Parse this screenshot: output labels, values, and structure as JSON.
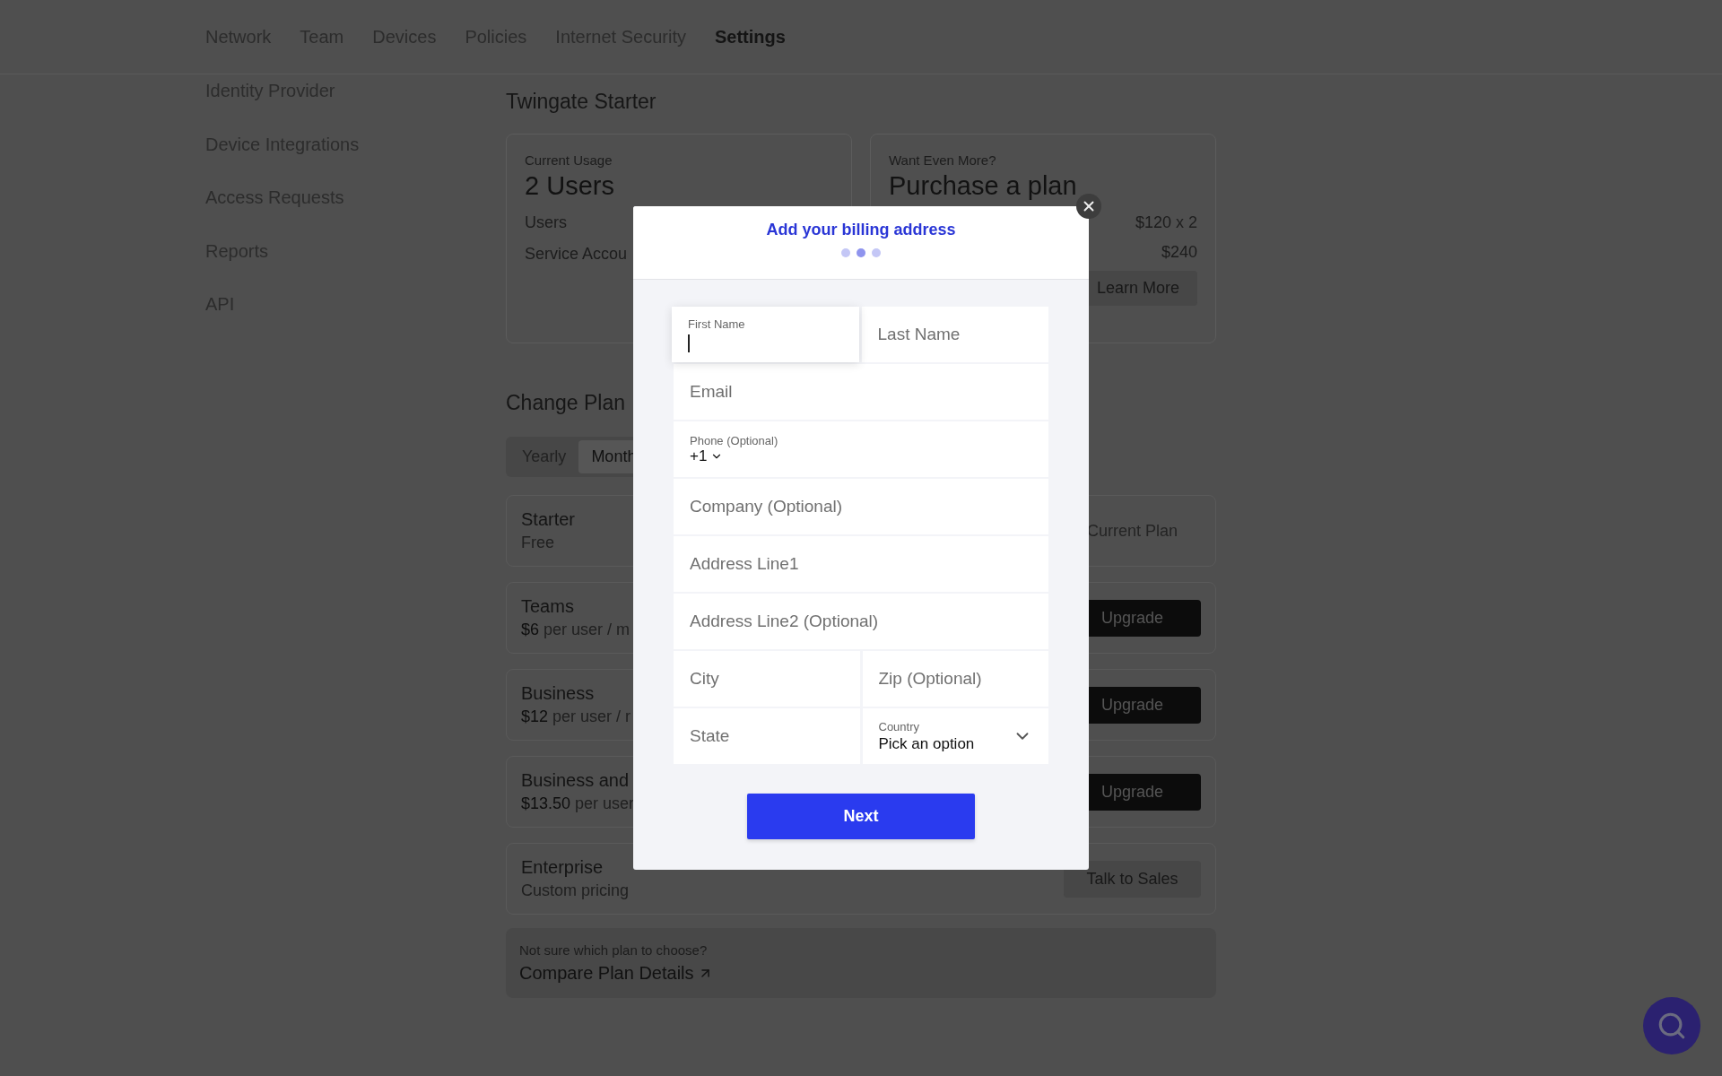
{
  "nav": {
    "tabs": [
      {
        "label": "Network",
        "selected": false
      },
      {
        "label": "Team",
        "selected": false
      },
      {
        "label": "Devices",
        "selected": false
      },
      {
        "label": "Policies",
        "selected": false
      },
      {
        "label": "Internet Security",
        "selected": false
      },
      {
        "label": "Settings",
        "selected": true
      }
    ]
  },
  "sidebar": {
    "items": [
      "Identity Provider",
      "Device Integrations",
      "Access Requests",
      "Reports",
      "API"
    ]
  },
  "starter": {
    "title": "Twingate Starter",
    "usage": {
      "caption": "Current Usage",
      "headline": "2 Users",
      "rows": [
        "Users",
        "Service Accou"
      ]
    },
    "purchase": {
      "caption": "Want Even More?",
      "headline": "Purchase a plan",
      "lines": [
        {
          "amount": "$120",
          "note": "x 2"
        },
        {
          "amount": "$240"
        }
      ],
      "button": "Learn More"
    }
  },
  "change_plan": {
    "title": "Change Plan",
    "billing_tabs": [
      {
        "label": "Yearly",
        "selected": false
      },
      {
        "label": "Month",
        "selected": true
      }
    ],
    "plans": [
      {
        "name": "Starter",
        "price_note": "Free",
        "action": {
          "kind": "current",
          "label": "Current Plan"
        }
      },
      {
        "name": "Teams",
        "price": "$6",
        "price_note": "per user / m",
        "action": {
          "kind": "upgrade",
          "label": "Upgrade"
        }
      },
      {
        "name": "Business",
        "price": "$12",
        "price_note": "per user / r",
        "action": {
          "kind": "upgrade",
          "label": "Upgrade"
        }
      },
      {
        "name": "Business and",
        "price": "$13.50",
        "price_note": "per user",
        "action": {
          "kind": "upgrade",
          "label": "Upgrade"
        }
      },
      {
        "name": "Enterprise",
        "price_note": "Custom pricing",
        "action": {
          "kind": "contact",
          "label": "Talk to Sales"
        }
      }
    ],
    "compare": {
      "question": "Not sure which plan to choose?",
      "link": "Compare Plan Details"
    }
  },
  "modal": {
    "title": "Add your billing address",
    "steps": [
      {
        "selected": false
      },
      {
        "selected": true
      },
      {
        "selected": false
      }
    ],
    "form_rows": [
      {
        "fields": [
          {
            "kind": "text",
            "label": "First Name",
            "focused": true
          },
          {
            "kind": "text",
            "label": "Last Name",
            "focused": false
          }
        ]
      },
      {
        "fields": [
          {
            "kind": "text",
            "label": "Email",
            "focused": false
          }
        ]
      },
      {
        "fields": [
          {
            "kind": "phone",
            "label": "Phone (Optional)",
            "value": "+1",
            "focused": false
          }
        ]
      },
      {
        "fields": [
          {
            "kind": "text",
            "label": "Company (Optional)",
            "focused": false
          }
        ]
      },
      {
        "fields": [
          {
            "kind": "text",
            "label": "Address Line1",
            "focused": false
          }
        ]
      },
      {
        "fields": [
          {
            "kind": "text",
            "label": "Address Line2 (Optional)",
            "focused": false
          }
        ]
      },
      {
        "fields": [
          {
            "kind": "text",
            "label": "City",
            "focused": false
          },
          {
            "kind": "text",
            "label": "Zip (Optional)",
            "focused": false
          }
        ]
      },
      {
        "fields": [
          {
            "kind": "text",
            "label": "State",
            "focused": false
          },
          {
            "kind": "select",
            "label": "Country",
            "value": "Pick an option",
            "focused": false
          }
        ]
      }
    ],
    "next_button": "Next"
  }
}
